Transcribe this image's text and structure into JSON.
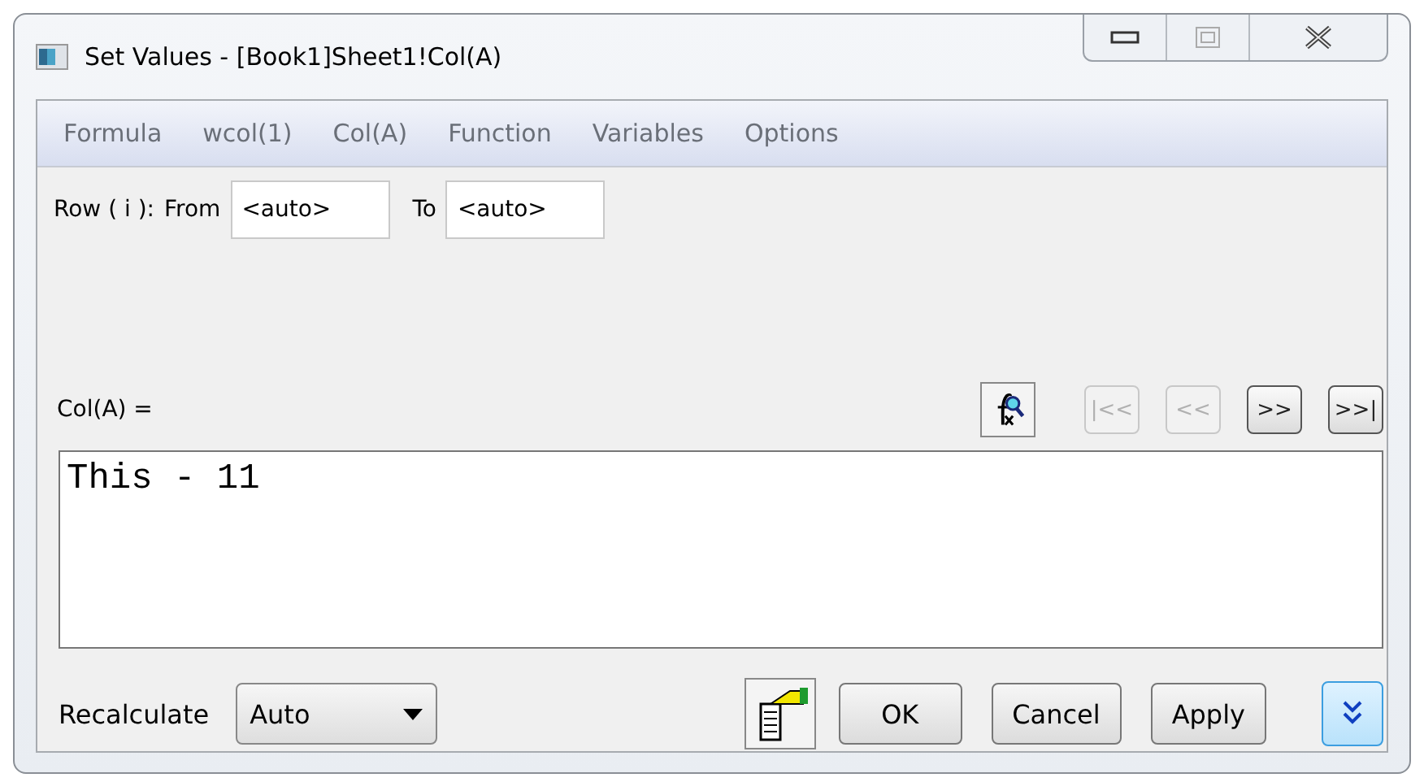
{
  "window": {
    "title": "Set Values - [Book1]Sheet1!Col(A)"
  },
  "menu": [
    "Formula",
    "wcol(1)",
    "Col(A)",
    "Function",
    "Variables",
    "Options"
  ],
  "row_range": {
    "label": "Row ( i ):",
    "from_label": "From",
    "from_value": "<auto>",
    "to_label": "To",
    "to_value": "<auto>"
  },
  "formula": {
    "label": "Col(A) =",
    "nav_buttons": [
      {
        "label": "|<<",
        "disabled": true
      },
      {
        "label": "<<",
        "disabled": true
      },
      {
        "label": ">>",
        "disabled": false
      },
      {
        "label": ">>|",
        "disabled": false
      }
    ],
    "value": "This - 11"
  },
  "recalculate": {
    "label": "Recalculate",
    "value": "Auto"
  },
  "buttons": [
    "OK",
    "Cancel",
    "Apply"
  ]
}
